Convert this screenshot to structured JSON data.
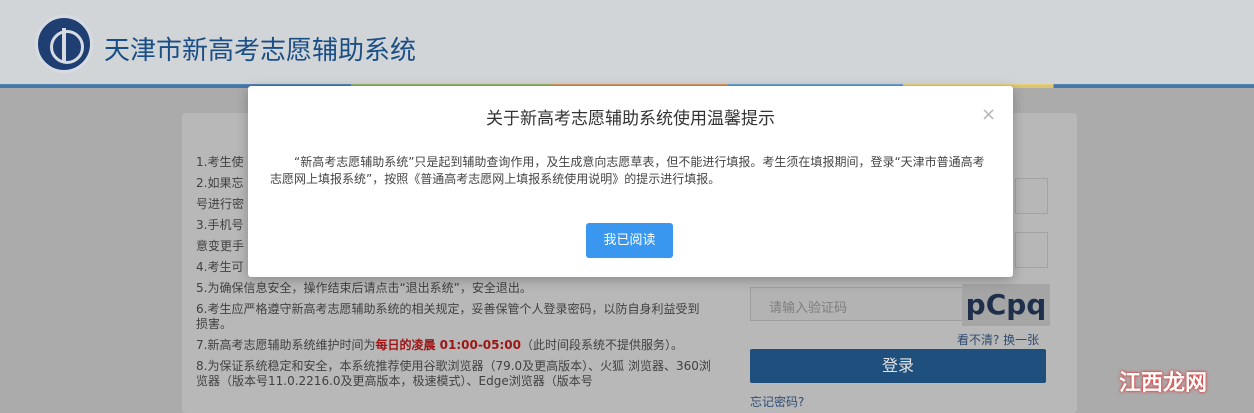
{
  "header": {
    "title": "天津市新高考志愿辅助系统"
  },
  "background": {
    "lines": [
      "1.考生使",
      "2.如果忘",
      "号进行密",
      "3.手机号",
      "意变更手",
      "4.考生可",
      "5.为确保信息安全，操作结束后请点击“退出系统”，安全退出。",
      "6.考生应严格遵守新高考志愿辅助系统的相关规定，妥善保管个人登录密码，以防自身利益受到损害。",
      "7.新高考志愿辅助系统维护时间为",
      "每日的凌晨 01:00-05:00",
      "（此时间段系统不提供服务）。",
      "8.为保证系统稳定和安全，本系统推荐使用谷歌浏览器（79.0及更高版本）、火狐 浏览器、360浏览器（版本号11.0.2216.0及更高版本，极速模式）、Edge浏览器（版本号"
    ],
    "login": {
      "captcha_placeholder": "请输入验证码",
      "captcha_text": "pCpq",
      "refresh_text": "看不清? 换一张",
      "login_button": "登录",
      "forgot_text": "忘记密码?"
    }
  },
  "modal": {
    "title": "关于新高考志愿辅助系统使用温馨提示",
    "close_icon": "×",
    "body": "“新高考志愿辅助系统”只是起到辅助查询作用，及生成意向志愿草表，但不能进行填报。考生须在填报期间，登录“天津市普通高考志愿网上填报系统”，按照《普通高考志愿网上填报系统使用说明》的提示进行填报。",
    "button": "我已阅读"
  },
  "watermark": {
    "text": "江西龙网"
  }
}
